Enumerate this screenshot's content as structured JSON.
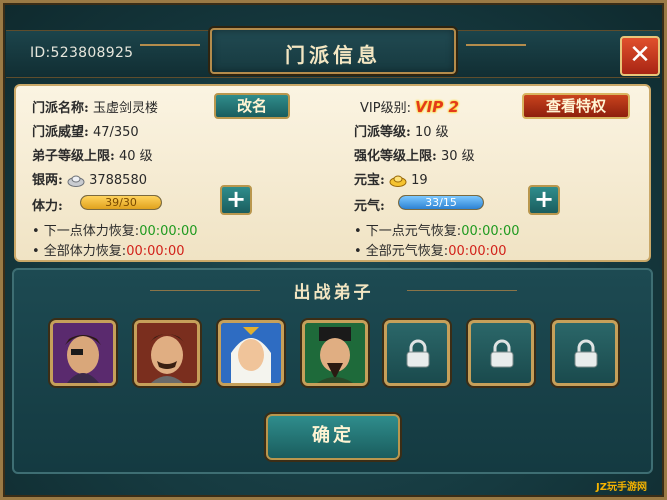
{
  "header": {
    "id_text": "ID:523808925",
    "title": "门派信息",
    "close_icon": "close-x-icon"
  },
  "info": {
    "sect_name_label": "门派名称:",
    "sect_name": "玉虚剑灵楼",
    "rename_button": "改名",
    "prestige_label": "门派威望:",
    "prestige": "47/350",
    "disciple_limit_label": "弟子等级上限:",
    "disciple_limit": "40 级",
    "silver_label": "银两:",
    "silver": "3788580",
    "stamina_label": "体力:",
    "stamina": "39/30",
    "stamina_fraction": 1.0,
    "vip_label": "VIP级别:",
    "vip_value": "VIP 2",
    "view_privilege_button": "查看特权",
    "sect_level_label": "门派等级:",
    "sect_level": "10 级",
    "enhance_limit_label": "强化等级上限:",
    "enhance_limit": "30 级",
    "yuanbao_label": "元宝:",
    "yuanbao": "19",
    "qi_label": "元气:",
    "qi": "33/15",
    "qi_fraction": 1.0,
    "next_stamina_label": "• 下一点体力恢复:",
    "next_stamina_time": "00:00:00",
    "all_stamina_label": "• 全部体力恢复:",
    "all_stamina_time": "00:00:00",
    "next_qi_label": "• 下一点元气恢复:",
    "next_qi_time": "00:00:00",
    "all_qi_label": "• 全部元气恢复:",
    "all_qi_time": "00:00:00",
    "colors": {
      "stamina_bar": "#f0b830",
      "qi_bar": "#3fa0e8",
      "green_time": "#1f9a1f",
      "red_time": "#d2221a"
    }
  },
  "lineup": {
    "title": "出战弟子",
    "slots": [
      {
        "type": "hero",
        "icon": "hero-eyepatch-portrait"
      },
      {
        "type": "hero",
        "icon": "hero-mustache-portrait"
      },
      {
        "type": "hero",
        "icon": "hero-white-hair-portrait"
      },
      {
        "type": "hero",
        "icon": "hero-scholar-portrait"
      },
      {
        "type": "locked",
        "icon": "lock-icon"
      },
      {
        "type": "locked",
        "icon": "lock-icon"
      },
      {
        "type": "locked",
        "icon": "lock-icon"
      }
    ]
  },
  "confirm_button": "确定",
  "watermark": "JZ玩手游网"
}
